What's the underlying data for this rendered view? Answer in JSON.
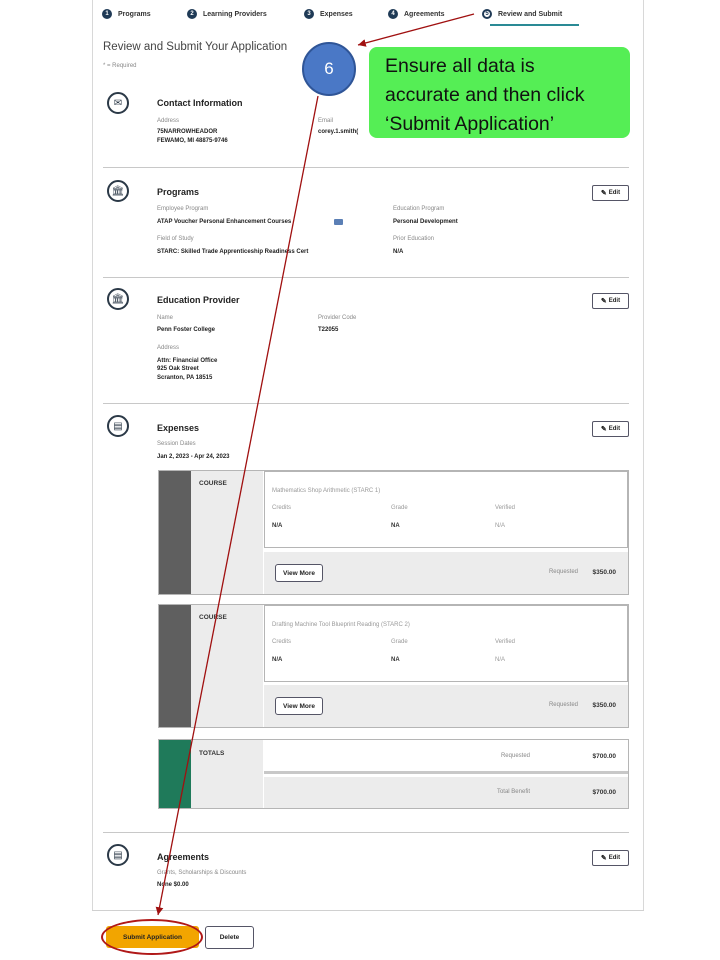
{
  "steps": [
    {
      "num": "1",
      "label": "Programs"
    },
    {
      "num": "2",
      "label": "Learning Providers"
    },
    {
      "num": "3",
      "label": "Expenses"
    },
    {
      "num": "4",
      "label": "Agreements"
    },
    {
      "num": "5",
      "label": "Review and Submit",
      "active": true
    }
  ],
  "page": {
    "title": "Review and Submit Your Application",
    "required_note": "* = Required"
  },
  "contact": {
    "title": "Contact Information",
    "address_label": "Address",
    "address_line1": "75NARROWHEADOR",
    "address_line2": "FEWAMO, MI 48875-9746",
    "email_label": "Email",
    "email_value": "corey.1.smith("
  },
  "programs": {
    "title": "Programs",
    "edit_label": "Edit",
    "employee_program_label": "Employee Program",
    "employee_program_value": "ATAP Voucher Personal Enhancement Courses",
    "education_program_label": "Education Program",
    "education_program_value": "Personal Development",
    "field_label": "Field of Study",
    "field_value": "STARC: Skilled Trade Apprenticeship Readiness Cert",
    "prior_label": "Prior Education",
    "prior_value": "N/A"
  },
  "provider": {
    "title": "Education Provider",
    "edit_label": "Edit",
    "name_label": "Name",
    "name_value": "Penn Foster College",
    "code_label": "Provider Code",
    "code_value": "T22055",
    "address_label": "Address",
    "address_line1": "Attn: Financial Office",
    "address_line2": "925 Oak Street",
    "address_line3": "Scranton, PA 18515"
  },
  "expenses": {
    "title": "Expenses",
    "edit_label": "Edit",
    "session_label": "Session Dates",
    "session_value": "Jan 2, 2023 - Apr 24, 2023",
    "courses": [
      {
        "kind": "COURSE",
        "name": "Mathematics Shop Arithmetic (STARC 1)",
        "credits_label": "Credits",
        "credits_value": "N/A",
        "grade_label": "Grade",
        "grade_value": "NA",
        "verified_label": "Verified",
        "verified_value": "N/A",
        "view_more": "View More",
        "requested_label": "Requested",
        "requested_value": "$350.00"
      },
      {
        "kind": "COURSE",
        "name": "Drafting Machine Tool Blueprint Reading (STARC 2)",
        "credits_label": "Credits",
        "credits_value": "N/A",
        "grade_label": "Grade",
        "grade_value": "NA",
        "verified_label": "Verified",
        "verified_value": "N/A",
        "view_more": "View More",
        "requested_label": "Requested",
        "requested_value": "$350.00"
      }
    ],
    "totals": {
      "label": "TOTALS",
      "requested_label": "Requested",
      "requested_value": "$700.00",
      "benefit_label": "Total Benefit",
      "benefit_value": "$700.00"
    }
  },
  "agreements": {
    "title": "Agreements",
    "edit_label": "Edit",
    "grants_label": "Grants, Scholarships & Discounts",
    "grants_value": "None $0.00"
  },
  "actions": {
    "submit_label": "Submit Application",
    "delete_label": "Delete"
  },
  "annotation": {
    "marker": "6",
    "callout_line1": "Ensure all data is",
    "callout_line2": "accurate and then click",
    "callout_line3": "‘Submit Application’",
    "callout_color": "#55ee55",
    "arrow_color": "#a01010"
  }
}
